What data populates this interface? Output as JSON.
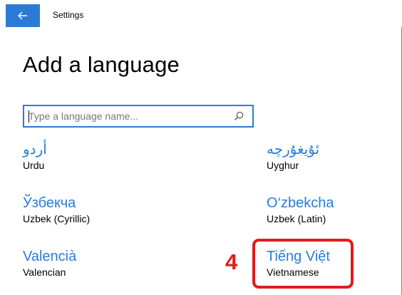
{
  "window": {
    "title": "Settings"
  },
  "page": {
    "title": "Add a language"
  },
  "search": {
    "placeholder": "Type a language name..."
  },
  "languages": [
    {
      "native": "أردو",
      "english": "Urdu"
    },
    {
      "native": "ئۇيغۇرچە",
      "english": "Uyghur"
    },
    {
      "native": "Ўзбекча",
      "english": "Uzbek (Cyrillic)"
    },
    {
      "native": "O‘zbekcha",
      "english": "Uzbek (Latin)"
    },
    {
      "native": "Valencià",
      "english": "Valencian"
    },
    {
      "native": "Tiếng Việt",
      "english": "Vietnamese"
    }
  ],
  "annotation": {
    "step_number": "4"
  },
  "colors": {
    "accent": "#2b7bd6",
    "highlight": "#e01c1c"
  },
  "icons": {
    "back": "back-arrow-icon",
    "search": "search-icon"
  }
}
